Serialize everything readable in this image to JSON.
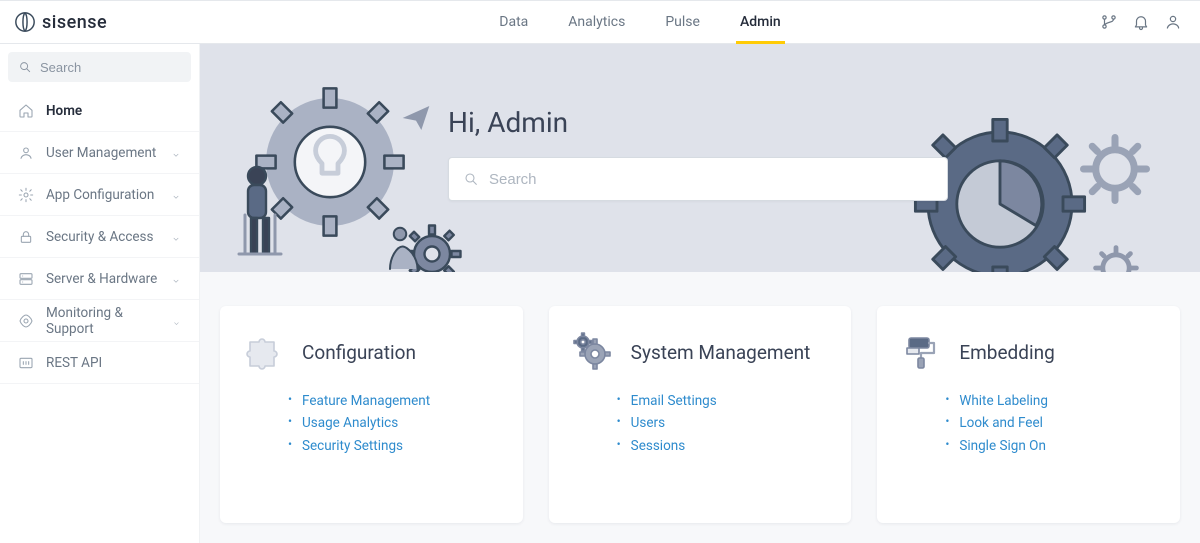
{
  "brand": "sisense",
  "topnav": {
    "items": [
      "Data",
      "Analytics",
      "Pulse",
      "Admin"
    ],
    "active_index": 3
  },
  "sidebar": {
    "search_placeholder": "Search",
    "items": [
      {
        "label": "Home",
        "icon": "home",
        "expandable": false,
        "active": true
      },
      {
        "label": "User Management",
        "icon": "user",
        "expandable": true,
        "active": false
      },
      {
        "label": "App Configuration",
        "icon": "gear",
        "expandable": true,
        "active": false
      },
      {
        "label": "Security & Access",
        "icon": "lock",
        "expandable": true,
        "active": false
      },
      {
        "label": "Server & Hardware",
        "icon": "server",
        "expandable": true,
        "active": false
      },
      {
        "label": "Monitoring & Support",
        "icon": "monitor",
        "expandable": true,
        "active": false
      },
      {
        "label": "REST API",
        "icon": "api",
        "expandable": false,
        "active": false
      }
    ]
  },
  "hero": {
    "greeting": "Hi, Admin",
    "search_placeholder": "Search"
  },
  "cards": [
    {
      "title": "Configuration",
      "icon": "puzzle",
      "links": [
        "Feature Management",
        "Usage Analytics",
        "Security Settings"
      ]
    },
    {
      "title": "System Management",
      "icon": "gears",
      "links": [
        "Email Settings",
        "Users",
        "Sessions"
      ]
    },
    {
      "title": "Embedding",
      "icon": "paint",
      "links": [
        "White Labeling",
        "Look and Feel",
        "Single Sign On"
      ]
    }
  ]
}
